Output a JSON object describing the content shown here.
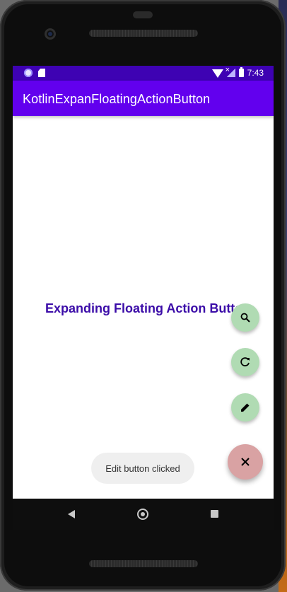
{
  "status_bar": {
    "time": "7:43",
    "icons": [
      "circle-notification-icon",
      "sd-card-icon",
      "wifi-icon",
      "no-signal-icon",
      "battery-icon"
    ]
  },
  "app_bar": {
    "title": "KotlinExpanFloatingActionButton",
    "color": "#6200ee"
  },
  "main": {
    "heading": "Expanding Floating Action Button"
  },
  "fabs": [
    {
      "name": "search-fab",
      "icon": "search-icon",
      "color": "#b0dbb3"
    },
    {
      "name": "refresh-fab",
      "icon": "refresh-icon",
      "color": "#b0dbb3"
    },
    {
      "name": "edit-fab",
      "icon": "pencil-icon",
      "color": "#b0dbb3"
    },
    {
      "name": "close-fab",
      "icon": "close-icon",
      "color": "#d9a2a3"
    }
  ],
  "toast": {
    "message": "Edit button clicked"
  },
  "nav_bar": {
    "buttons": [
      "back-icon",
      "home-icon",
      "recents-icon"
    ]
  }
}
